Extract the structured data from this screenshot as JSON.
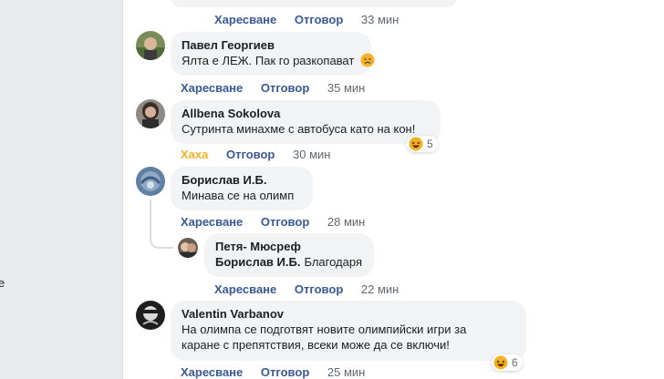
{
  "page": {
    "edge_char": "е"
  },
  "comments": [
    {
      "id": "top",
      "actions": {
        "like": "Харесване",
        "reply": "Отговор",
        "time": "33 мин"
      }
    },
    {
      "id": "pavel",
      "author": "Павел Георгиев",
      "text": "Ялта е ЛЕЖ. Пак го разкопават",
      "emoji": "sad-emoji",
      "actions": {
        "like": "Харесване",
        "reply": "Отговор",
        "time": "35 мин"
      }
    },
    {
      "id": "allbena",
      "author": "Allbena Sokolova",
      "text": "Сутринта минахме с автобуса като на кон!",
      "reaction": {
        "icon": "haha-icon",
        "count": "5"
      },
      "actions": {
        "like": "Хаха",
        "reply": "Отговор",
        "time": "30 мин"
      }
    },
    {
      "id": "borislav",
      "author": "Борислав И.Б.",
      "text": "Минава се на олимп",
      "actions": {
        "like": "Харесване",
        "reply": "Отговор",
        "time": "28 мин"
      }
    },
    {
      "id": "petya",
      "author": "Петя- Мюсреф",
      "tag": "Борислав И.Б.",
      "text": "Благодаря",
      "actions": {
        "like": "Харесване",
        "reply": "Отговор",
        "time": "22 мин"
      }
    },
    {
      "id": "valentin",
      "author": "Valentin Varbanov",
      "text_line1": "На олимпа се подготвят новите олимпийски игри за",
      "text_line2": "каране с препятствия, всеки може да се включи!",
      "reaction": {
        "icon": "haha-icon",
        "count": "6"
      },
      "actions": {
        "like": "Харесване",
        "reply": "Отговор",
        "time": "25 мин"
      }
    }
  ],
  "colors": {
    "link": "#385898",
    "haha": "#f7b125",
    "bubble": "#f2f3f5",
    "meta": "#606770"
  }
}
